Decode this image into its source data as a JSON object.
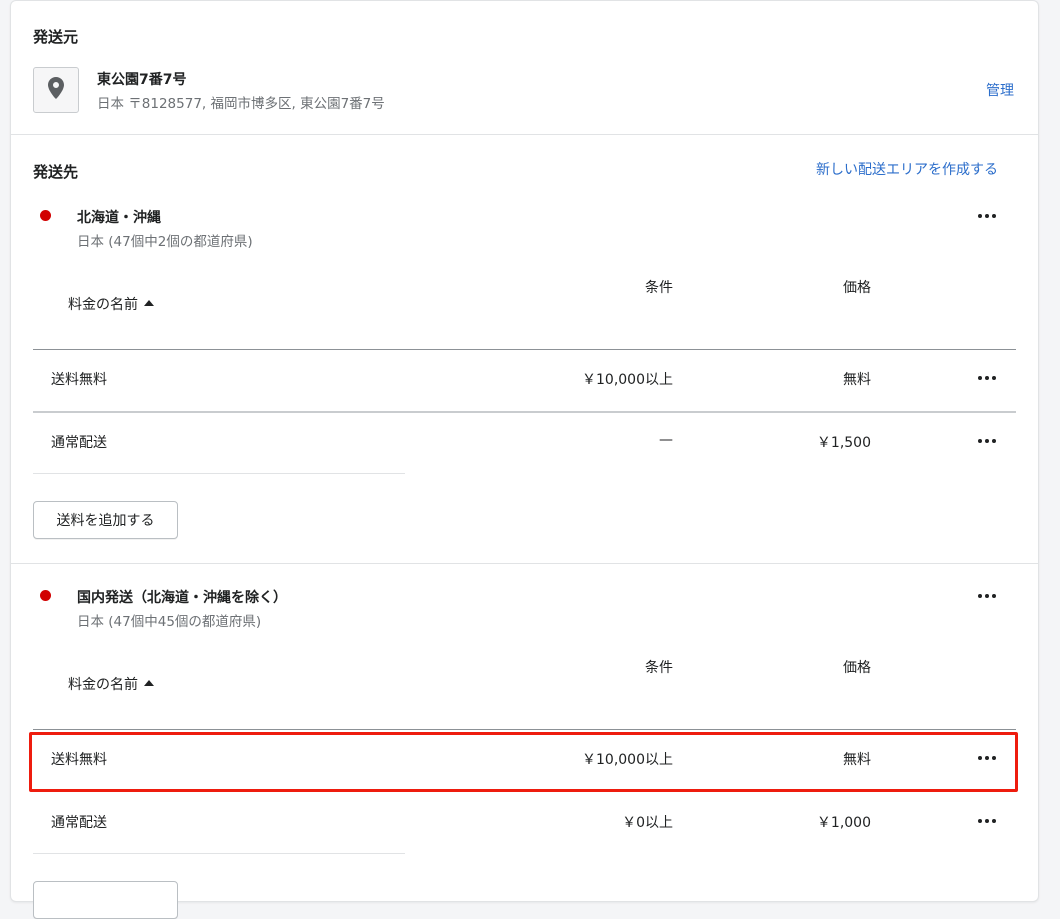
{
  "origin": {
    "title": "発送元",
    "location_name": "東公園7番7号",
    "address": "日本 〒8128577, 福岡市博多区, 東公園7番7号",
    "manage_link": "管理"
  },
  "destinations": {
    "title": "発送先",
    "create_zone_link": "新しい配送エリアを作成する"
  },
  "zones": [
    {
      "name": "北海道・沖縄",
      "subtitle": "日本 (47個中2個の都道府県)",
      "columns": {
        "name": "料金の名前",
        "condition": "条件",
        "price": "価格"
      },
      "rates": [
        {
          "name": "送料無料",
          "condition": "￥10,000以上",
          "price": "無料"
        },
        {
          "name": "通常配送",
          "condition": "—",
          "price": "￥1,500"
        }
      ],
      "add_button": "送料を追加する"
    },
    {
      "name": "国内発送（北海道・沖縄を除く）",
      "subtitle": "日本 (47個中45個の都道府県)",
      "columns": {
        "name": "料金の名前",
        "condition": "条件",
        "price": "価格"
      },
      "rates": [
        {
          "name": "送料無料",
          "condition": "￥10,000以上",
          "price": "無料"
        },
        {
          "name": "通常配送",
          "condition": "￥0以上",
          "price": "￥1,000"
        }
      ],
      "add_button": ""
    }
  ],
  "colors": {
    "zone_dot": "#d10000",
    "link": "#2c6ecb",
    "highlight": "#ee1c0e"
  },
  "icons": {
    "location": "location-pin-icon",
    "more": "more-horizontal-icon",
    "sort": "sort-up-icon"
  }
}
